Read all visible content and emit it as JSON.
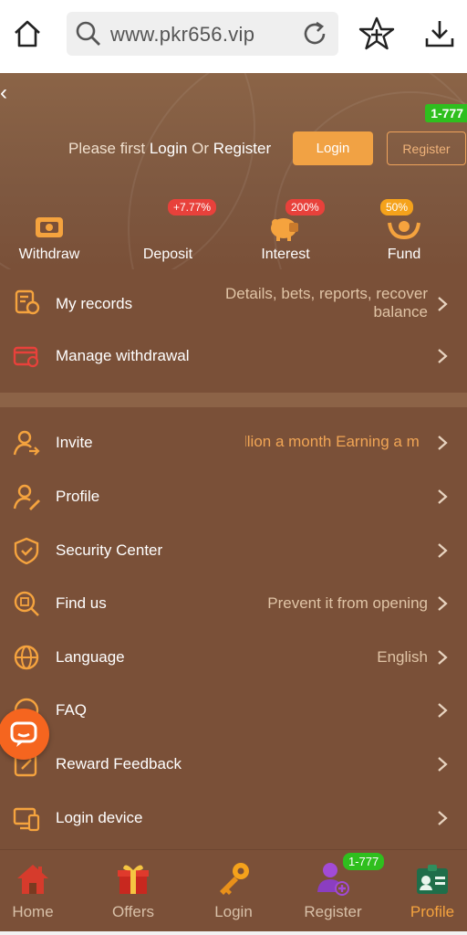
{
  "browser": {
    "url": "www.pkr656.vip",
    "icons": [
      "home-icon",
      "search-icon",
      "reload-icon",
      "star-icon",
      "download-icon"
    ]
  },
  "header": {
    "back_glyph": "‹",
    "bonus_tag": "1-777",
    "prompt_prefix": "Please first",
    "prompt_login": "Login",
    "prompt_or": "Or",
    "prompt_register": "Register",
    "login_button": "Login",
    "register_button": "Register"
  },
  "quick_actions": [
    {
      "label": "Withdraw",
      "badge": "",
      "icon": "withdraw-icon"
    },
    {
      "label": "Deposit",
      "badge": "+7.77%",
      "icon": "deposit-icon"
    },
    {
      "label": "Interest",
      "badge": "200%",
      "icon": "piggy-bank-icon"
    },
    {
      "label": "Fund",
      "badge": "50%",
      "icon": "fund-icon"
    }
  ],
  "menu_top": [
    {
      "label": "My records",
      "value": "Details, bets, reports, recover balance",
      "icon": "records-icon"
    },
    {
      "label": "Manage withdrawal",
      "value": "",
      "icon": "wallet-icon"
    }
  ],
  "menu": [
    {
      "label": "Invite",
      "value": "",
      "icon": "invite-icon"
    },
    {
      "label": "Profile",
      "value": "",
      "icon": "profile-icon"
    },
    {
      "label": "Security Center",
      "value": "",
      "icon": "shield-icon"
    },
    {
      "label": "Find us",
      "value": "Prevent it from opening",
      "icon": "find-icon"
    },
    {
      "label": "Language",
      "value": "English",
      "icon": "globe-icon"
    },
    {
      "label": "FAQ",
      "value": "",
      "icon": "faq-icon"
    },
    {
      "label": "Reward Feedback",
      "value": "",
      "icon": "feedback-icon"
    },
    {
      "label": "Login device",
      "value": "",
      "icon": "device-icon"
    }
  ],
  "invite_marquee": "llion a month  Earning a m",
  "bottom_nav": [
    {
      "label": "Home",
      "icon": "home-house-icon",
      "active": false
    },
    {
      "label": "Offers",
      "icon": "gift-icon",
      "active": false
    },
    {
      "label": "Login",
      "icon": "key-icon",
      "active": false
    },
    {
      "label": "Register",
      "icon": "add-user-icon",
      "active": false
    },
    {
      "label": "Profile",
      "icon": "id-card-icon",
      "active": true
    }
  ],
  "register_nav_badge": "1-777",
  "colors": {
    "accent": "#f1a244",
    "background": "#7a5038",
    "badge_green": "#2fbf1e",
    "badge_red": "#e8413b"
  }
}
